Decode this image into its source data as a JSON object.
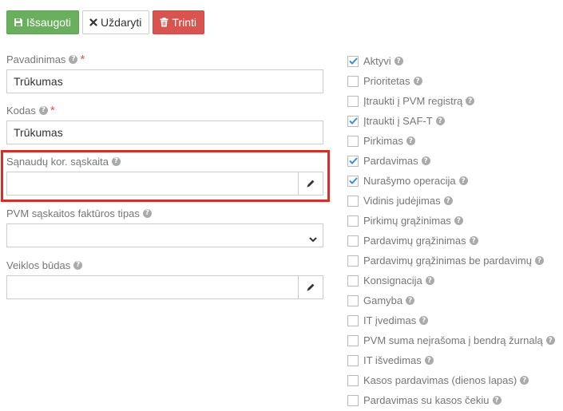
{
  "toolbar": {
    "save_label": "Išsaugoti",
    "close_label": "Uždaryti",
    "delete_label": "Trinti"
  },
  "fields": {
    "name": {
      "label": "Pavadinimas",
      "value": "Trūkumas",
      "required": true
    },
    "code": {
      "label": "Kodas",
      "value": "Trūkumas",
      "required": true
    },
    "expense_account": {
      "label": "Sąnaudų kor. sąskaita",
      "value": ""
    },
    "vat_invoice_type": {
      "label": "PVM sąskaitos faktūros tipas",
      "value": ""
    },
    "activity_type": {
      "label": "Veiklos būdas",
      "value": ""
    }
  },
  "checkboxes": [
    {
      "label": "Aktyvi",
      "checked": true
    },
    {
      "label": "Prioritetas",
      "checked": false
    },
    {
      "label": "Įtraukti į PVM registrą",
      "checked": false
    },
    {
      "label": "Įtraukti į SAF-T",
      "checked": true
    },
    {
      "label": "Pirkimas",
      "checked": false
    },
    {
      "label": "Pardavimas",
      "checked": true
    },
    {
      "label": "Nurašymo operacija",
      "checked": true
    },
    {
      "label": "Vidinis judėjimas",
      "checked": false
    },
    {
      "label": "Pirkimų grąžinimas",
      "checked": false
    },
    {
      "label": "Pardavimų grąžinimas",
      "checked": false
    },
    {
      "label": "Pardavimų grąžinimas be pardavimų",
      "checked": false
    },
    {
      "label": "Konsignacija",
      "checked": false
    },
    {
      "label": "Gamyba",
      "checked": false
    },
    {
      "label": "IT įvedimas",
      "checked": false
    },
    {
      "label": "PVM suma neįrašoma į bendrą žurnalą",
      "checked": false
    },
    {
      "label": "IT išvedimas",
      "checked": false
    },
    {
      "label": "Kasos pardavimas (dienos lapas)",
      "checked": false
    },
    {
      "label": "Pardavimas su kasos čekiu",
      "checked": false
    }
  ],
  "colors": {
    "save": "#6aaf5e",
    "delete": "#d9534f",
    "check_accent": "#3a8fd6",
    "highlight": "#d0312d"
  }
}
